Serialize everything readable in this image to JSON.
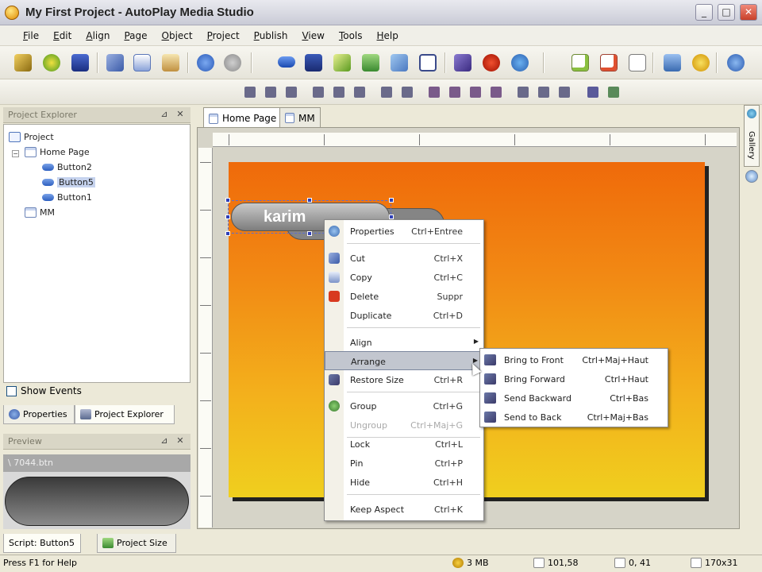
{
  "window": {
    "title": "My First Project - AutoPlay Media Studio",
    "minimize": "_",
    "maximize": "□",
    "close": "✕"
  },
  "menu": [
    "File",
    "Edit",
    "Align",
    "Page",
    "Object",
    "Project",
    "Publish",
    "View",
    "Tools",
    "Help"
  ],
  "project_explorer": {
    "header": "Project Explorer",
    "tree": {
      "root": "Project",
      "home_page": "Home Page",
      "buttons": [
        "Button2",
        "Button5",
        "Button1"
      ],
      "selected": "Button5",
      "mm": "MM"
    },
    "show_events": "Show Events"
  },
  "panel_tabs": {
    "properties": "Properties",
    "project_explorer": "Project Explorer"
  },
  "preview": {
    "header": "Preview",
    "path": "\\ 7044.btn"
  },
  "bottom_tabs": {
    "script": "Script: Button5",
    "project_size": "Project Size"
  },
  "doc_tabs": [
    "Home Page",
    "MM"
  ],
  "gallery": "Gallery",
  "canvas": {
    "button_label": "karim"
  },
  "context_menu": [
    {
      "label": "Properties",
      "shortcut": "Ctrl+Entree",
      "icon": "magnifier-icon"
    },
    {
      "label": "Cut",
      "shortcut": "Ctrl+X",
      "icon": "scissors-icon"
    },
    {
      "label": "Copy",
      "shortcut": "Ctrl+C",
      "icon": "copy-icon"
    },
    {
      "label": "Delete",
      "shortcut": "Suppr",
      "icon": "delete-icon"
    },
    {
      "label": "Duplicate",
      "shortcut": "Ctrl+D",
      "icon": ""
    },
    {
      "label": "Align",
      "shortcut": "",
      "icon": ""
    },
    {
      "label": "Arrange",
      "shortcut": "",
      "icon": ""
    },
    {
      "label": "Restore Size",
      "shortcut": "Ctrl+R",
      "icon": "restore-size-icon"
    },
    {
      "label": "Group",
      "shortcut": "Ctrl+G",
      "icon": "group-icon"
    },
    {
      "label": "Ungroup",
      "shortcut": "Ctrl+Maj+G",
      "icon": ""
    },
    {
      "label": "Lock",
      "shortcut": "Ctrl+L",
      "icon": ""
    },
    {
      "label": "Pin",
      "shortcut": "Ctrl+P",
      "icon": ""
    },
    {
      "label": "Hide",
      "shortcut": "Ctrl+H",
      "icon": ""
    },
    {
      "label": "Keep Aspect",
      "shortcut": "Ctrl+K",
      "icon": ""
    }
  ],
  "arrange_submenu": [
    {
      "label": "Bring to Front",
      "shortcut": "Ctrl+Maj+Haut"
    },
    {
      "label": "Bring Forward",
      "shortcut": "Ctrl+Haut"
    },
    {
      "label": "Send Backward",
      "shortcut": "Ctrl+Bas"
    },
    {
      "label": "Send to Back",
      "shortcut": "Ctrl+Maj+Bas"
    }
  ],
  "status": {
    "help": "Press F1 for Help",
    "size": "3 MB",
    "position": "101,58",
    "zoom": "0, 41",
    "dimensions": "170x31"
  },
  "colors": {
    "canvas_top": "#ef6a0a",
    "canvas_bottom": "#f0cf1e",
    "menu_highlight": "#c2c6cf"
  }
}
